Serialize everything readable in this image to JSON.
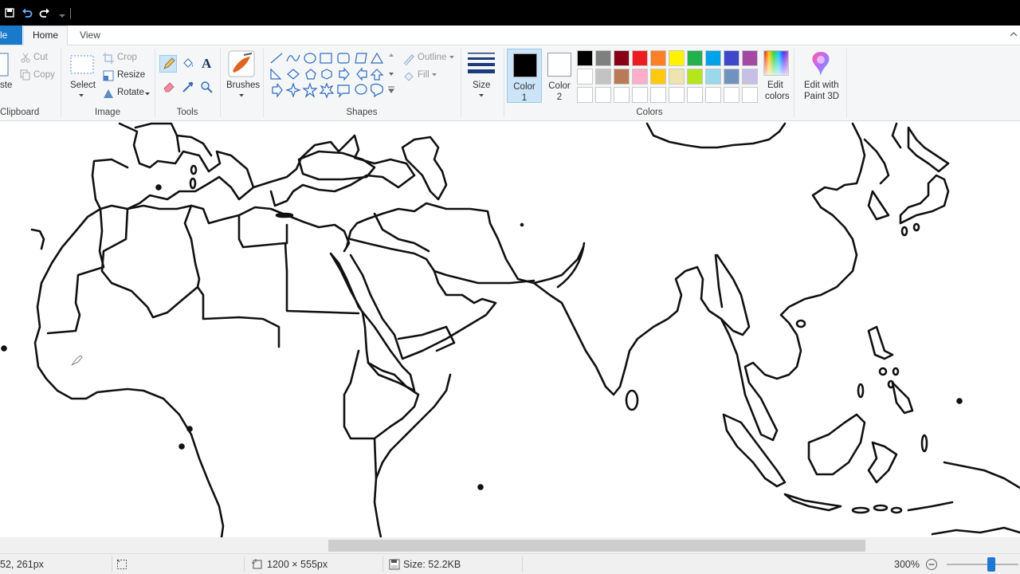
{
  "quick_access": {
    "icons": [
      "save-icon",
      "undo-icon",
      "redo-icon",
      "customize-icon"
    ]
  },
  "tabs": {
    "file": "le",
    "home": "Home",
    "view": "View"
  },
  "ribbon": {
    "clipboard": {
      "paste_label": "ste",
      "cut_label": "Cut",
      "copy_label": "Copy",
      "group_label": "Clipboard"
    },
    "image": {
      "select_label": "Select",
      "crop_label": "Crop",
      "resize_label": "Resize",
      "rotate_label": "Rotate",
      "group_label": "Image"
    },
    "tools": {
      "group_label": "Tools",
      "active_tool": "pencil"
    },
    "brushes": {
      "label": "Brushes"
    },
    "shapes": {
      "outline_label": "Outline",
      "fill_label": "Fill",
      "group_label": "Shapes"
    },
    "size": {
      "label": "Size"
    },
    "colors": {
      "color1_label_a": "Color",
      "color1_label_b": "1",
      "color2_label_a": "Color",
      "color2_label_b": "2",
      "color1": "#000000",
      "color2": "#ffffff",
      "edit_colors_a": "Edit",
      "edit_colors_b": "colors",
      "paint3d_a": "Edit with",
      "paint3d_b": "Paint 3D",
      "group_label": "Colors",
      "palette_row1": [
        "#000000",
        "#7f7f7f",
        "#880015",
        "#ed1c24",
        "#ff7f27",
        "#fff200",
        "#22b14c",
        "#00a2e8",
        "#3f48cc",
        "#a349a4"
      ],
      "palette_row2": [
        "#ffffff",
        "#c3c3c3",
        "#b97a57",
        "#ffaec9",
        "#ffc90e",
        "#efe4b0",
        "#b5e61d",
        "#99d9ea",
        "#7092be",
        "#c8bfe7"
      ],
      "palette_row3": [
        "#ffffff",
        "#ffffff",
        "#ffffff",
        "#ffffff",
        "#ffffff",
        "#ffffff",
        "#ffffff",
        "#ffffff",
        "#ffffff",
        "#ffffff"
      ]
    }
  },
  "status": {
    "cursor_pos": "52, 261px",
    "canvas_dimensions": "1200 × 555px",
    "file_size": "Size: 52.2KB",
    "zoom": "300%"
  }
}
